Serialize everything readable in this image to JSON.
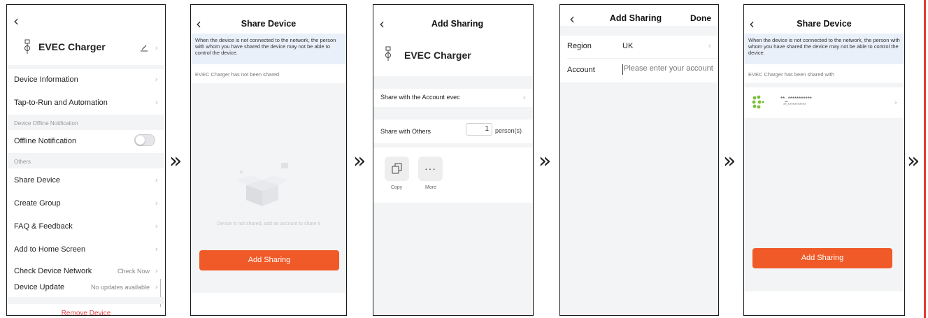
{
  "screen1": {
    "device_name": "EVEC Charger",
    "rows": {
      "device_information": "Device Information",
      "tap_to_run": "Tap-to-Run and Automation",
      "offline_section": "Device Offline Notification",
      "offline_notification": "Offline Notification",
      "offline_toggle_on": false,
      "others_section": "Others",
      "share_device": "Share Device",
      "create_group": "Create Group",
      "faq": "FAQ & Feedback",
      "add_home": "Add to Home Screen",
      "check_network": "Check Device Network",
      "check_network_value": "Check Now",
      "device_update": "Device Update",
      "device_update_value": "No updates available",
      "remove_device": "Remove Device"
    }
  },
  "screen2": {
    "title": "Share Device",
    "notice": "When the device is not connected to the network, the person with whom you have shared the device may not be able to control the device.",
    "status": "EVEC Charger has not been shared",
    "empty_text": "Device is not shared, add an account to share it",
    "button": "Add Sharing"
  },
  "screen3": {
    "title": "Add Sharing",
    "device_name": "EVEC Charger",
    "share_account": "Share with the Account evec",
    "share_others": "Share with Others",
    "person_count": "1",
    "person_unit": "person(s)",
    "copy_label": "Copy",
    "more_label": "More"
  },
  "screen4": {
    "title": "Add Sharing",
    "done": "Done",
    "region_label": "Region",
    "region_value": "UK",
    "account_label": "Account",
    "account_placeholder": "Please enter your account"
  },
  "screen5": {
    "title": "Share Device",
    "notice": "When the device is not connected to the network, the person with whom you have shared the device may not be able to control the device.",
    "status": "EVEC Charger has been shared with",
    "user_line1": "**_***********",
    "user_line2": "**-***********",
    "button": "Add Sharing"
  },
  "glyphs": {
    "back": "‹",
    "chevron": "›",
    "step_arrow": "»"
  },
  "colors": {
    "accent_orange": "#f05a28",
    "remove_red": "#e0454b",
    "notice_blue": "#e9f0fa",
    "avatar_green": "#7bbf3a",
    "divider_red": "#e53935"
  }
}
